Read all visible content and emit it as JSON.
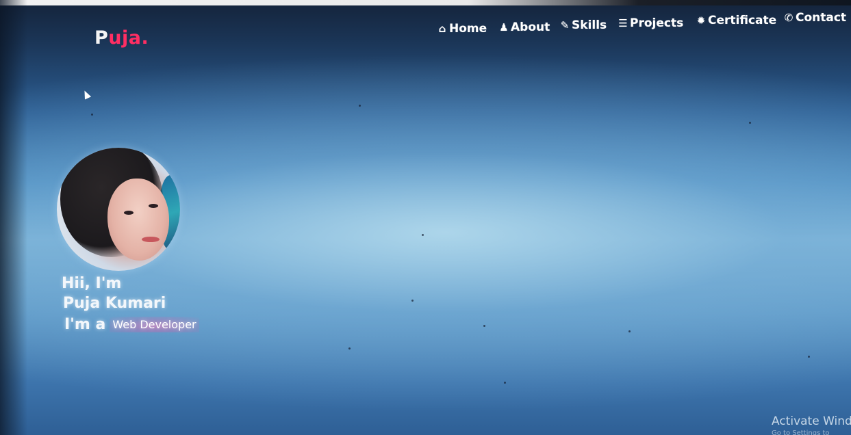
{
  "brand": {
    "logo_first": "P",
    "logo_rest": "uja."
  },
  "nav": {
    "home": "Home",
    "about": "About",
    "skills": "Skills",
    "projects": "Projects",
    "certificate": "Certificate",
    "contact": "Contact"
  },
  "hero": {
    "greeting": "Hii, I'm",
    "name": "Puja Kumari",
    "prefix": "I'm a",
    "role": "Web Developer"
  },
  "watermark": {
    "text": "Activate Wind",
    "sub": "Go to Settings to"
  },
  "colors": {
    "accent": "#ff2e63",
    "background_top": "#14233a",
    "background_mid": "#7fb6d9"
  },
  "icons": {
    "home": "home-icon",
    "about": "user-icon",
    "skills": "wrench-icon",
    "projects": "list-icon",
    "certificate": "badge-icon",
    "contact": "phone-icon"
  }
}
